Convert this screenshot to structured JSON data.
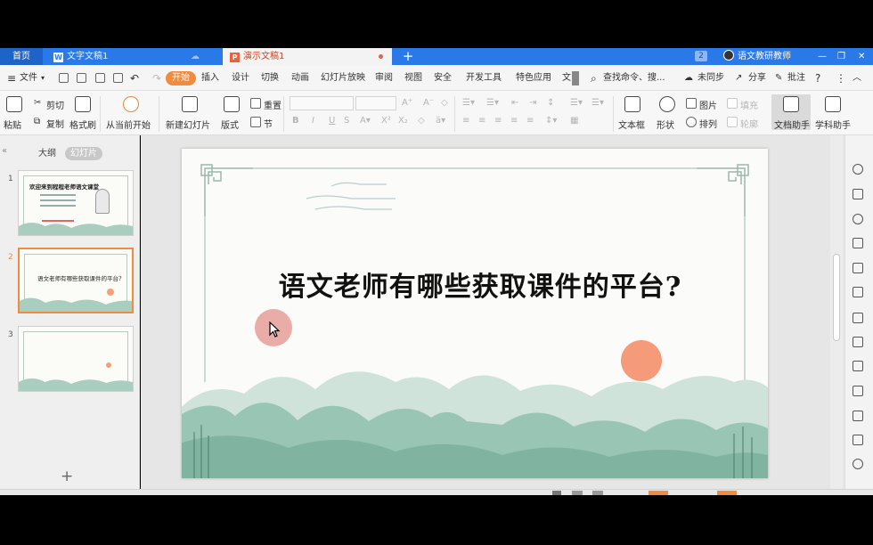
{
  "tabbar": {
    "home": "首页",
    "doc_tab": "文字文稿1",
    "ppt_tab": "演示文稿1",
    "new_tab": "+",
    "badge": "2",
    "user": "语文教研教师"
  },
  "menu": {
    "file": "文件",
    "start": "开始",
    "items": [
      "插入",
      "设计",
      "切换",
      "动画",
      "幻灯片放映",
      "审阅",
      "视图",
      "安全",
      "开发工具",
      "特色应用",
      "文"
    ],
    "search": "查找命令、搜...",
    "sync": "未同步",
    "share": "分享",
    "comment": "批注"
  },
  "ribbon": {
    "paste": "粘贴",
    "cut": "剪切",
    "copy": "复制",
    "format_painter": "格式刷",
    "from_current": "从当前开始",
    "new_slide": "新建幻灯片",
    "layout": "版式",
    "reset": "重置",
    "section": "节",
    "bold": "B",
    "italic": "I",
    "underline": "U",
    "textbox": "文本框",
    "shape": "形状",
    "picture": "图片",
    "arrange": "排列",
    "fill": "填充",
    "outline": "轮廓",
    "doc_assistant": "文档助手",
    "subject_assistant": "学科助手"
  },
  "left_panel": {
    "outline_tab": "大纲",
    "slides_tab": "幻灯片",
    "slides": [
      {
        "num": "1",
        "title": "欢迎来到程程老师语文课堂"
      },
      {
        "num": "2",
        "title": "语文老师有哪些获取课件的平台?"
      },
      {
        "num": "3",
        "title": ""
      }
    ],
    "add": "+"
  },
  "slide": {
    "title": "语文老师有哪些获取课件的平台?"
  },
  "colors": {
    "tab_blue": "#2a79e8",
    "accent_orange": "#f08b40",
    "sun": "#f4906a",
    "mountain": "#8fbfae"
  }
}
